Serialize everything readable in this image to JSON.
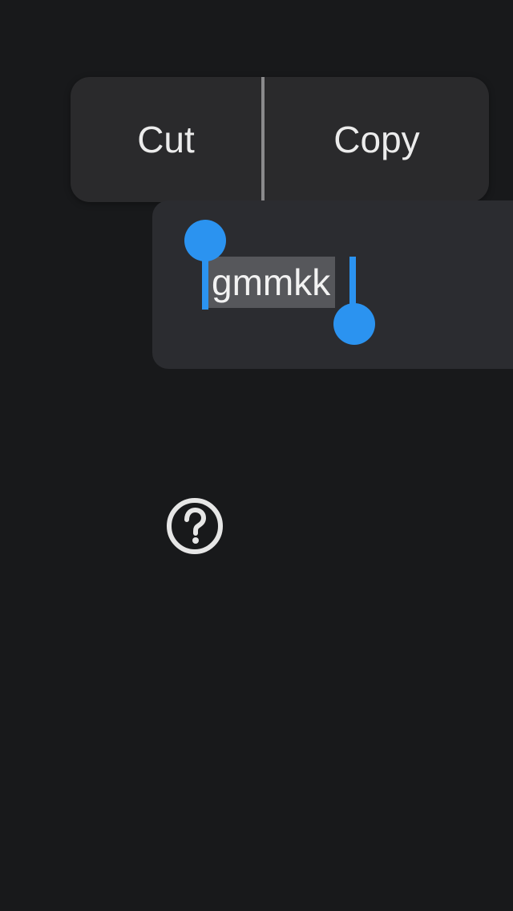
{
  "context_menu": {
    "cut_label": "Cut",
    "copy_label": "Copy"
  },
  "text_field": {
    "value": "gmmkk",
    "selected_text": "gmmkk"
  },
  "icons": {
    "help": "question-circle-icon"
  },
  "colors": {
    "background": "#18191b",
    "menu_background": "#2a2a2c",
    "field_background": "#2b2c30",
    "selection_handle": "#2b93f0",
    "selection_highlight": "#56575b"
  }
}
